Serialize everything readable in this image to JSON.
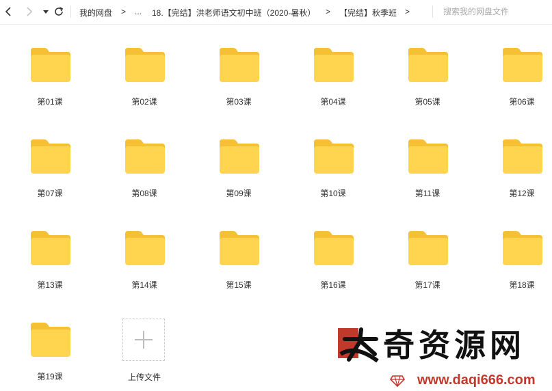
{
  "colors": {
    "folder": "#FFD54F",
    "folder_tab": "#F5C033",
    "accent": "#c0392b"
  },
  "nav": {
    "back_icon": "chevron-left-icon",
    "forward_icon": "chevron-right-icon",
    "dropdown_icon": "caret-down-icon",
    "refresh_icon": "refresh-icon"
  },
  "breadcrumb": {
    "items": [
      "我的网盘",
      "...",
      "18.【完结】洪老师语文初中班（2020-暑秋）",
      "【完结】秋季班"
    ],
    "separator": ">"
  },
  "search": {
    "placeholder": "搜索我的网盘文件"
  },
  "folders": [
    "第01课",
    "第02课",
    "第03课",
    "第04课",
    "第05课",
    "第06课",
    "第07课",
    "第08课",
    "第09课",
    "第10课",
    "第11课",
    "第12课",
    "第13课",
    "第14课",
    "第15课",
    "第16课",
    "第17课",
    "第18课",
    "第19课"
  ],
  "upload": {
    "label": "上传文件",
    "icon": "plus-icon"
  },
  "watermark": {
    "title": "奇资源网",
    "url": "www.daqi666.com",
    "logo_text": "大"
  }
}
